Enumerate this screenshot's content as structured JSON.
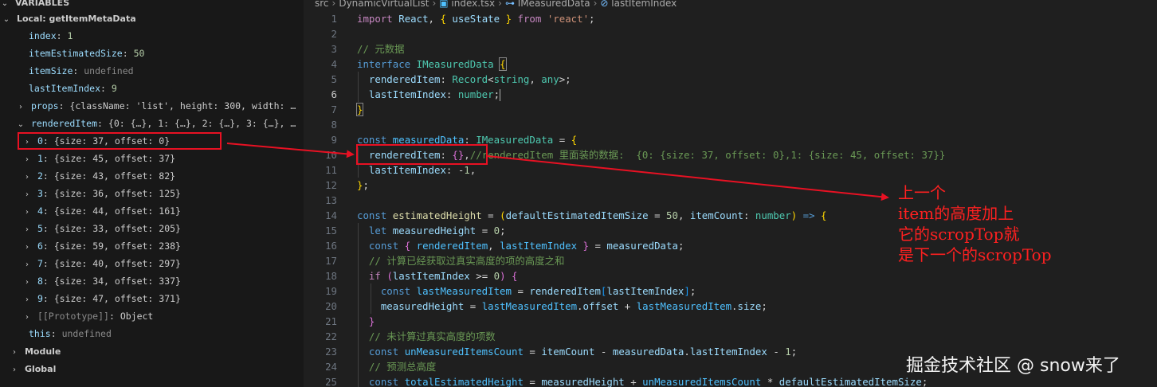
{
  "variables": {
    "header": "VARIABLES",
    "local_scope": "Local: getItemMetaData",
    "locals": [
      {
        "name": "index",
        "value": "1"
      },
      {
        "name": "itemEstimatedSize",
        "value": "50"
      },
      {
        "name": "itemSize",
        "value": "undefined"
      },
      {
        "name": "lastItemIndex",
        "value": "9"
      }
    ],
    "props": {
      "name": "props",
      "value": "{className: 'list', height: 300, width: …"
    },
    "rendered_item": {
      "name": "renderedItem",
      "value": "{0: {…}, 1: {…}, 2: {…}, 3: {…}, …"
    },
    "entries": [
      {
        "key": "0",
        "value": "{size: 37, offset: 0}"
      },
      {
        "key": "1",
        "value": "{size: 45, offset: 37}"
      },
      {
        "key": "2",
        "value": "{size: 43, offset: 82}"
      },
      {
        "key": "3",
        "value": "{size: 36, offset: 125}"
      },
      {
        "key": "4",
        "value": "{size: 44, offset: 161}"
      },
      {
        "key": "5",
        "value": "{size: 33, offset: 205}"
      },
      {
        "key": "6",
        "value": "{size: 59, offset: 238}"
      },
      {
        "key": "7",
        "value": "{size: 40, offset: 297}"
      },
      {
        "key": "8",
        "value": "{size: 34, offset: 337}"
      },
      {
        "key": "9",
        "value": "{size: 47, offset: 371}"
      }
    ],
    "prototype": {
      "name": "[[Prototype]]",
      "value": "Object"
    },
    "this": {
      "name": "this",
      "value": "undefined"
    },
    "scopes": [
      "Module",
      "Global"
    ]
  },
  "breadcrumbs": [
    "src",
    "DynamicVirtualList",
    "index.tsx",
    "IMeasuredData",
    "lastItemIndex"
  ],
  "code": {
    "line_numbers": [
      "1",
      "2",
      "3",
      "4",
      "5",
      "6",
      "7",
      "8",
      "9",
      "10",
      "11",
      "12",
      "13",
      "14",
      "15",
      "16",
      "17",
      "18",
      "19",
      "20",
      "21",
      "22",
      "23",
      "24",
      "25"
    ],
    "comment_metadata": "// 元数据",
    "comment_rendered": "//renderedItem 里面装的数据:  {0: {size: 37, offset: 0},1: {size: 45, offset: 37}}",
    "comment_sum": "// 计算已经获取过真实高度的项的高度之和",
    "comment_unmeasured": "// 未计算过真实高度的项数",
    "comment_total": "// 预测总高度",
    "module_react": "'react'"
  },
  "annotation": {
    "lines": [
      "上一个",
      "item的高度加上",
      "它的scropTop就",
      "是下一个的scropTop"
    ]
  },
  "watermark": "掘金技术社区 @ snow来了",
  "colors": {
    "annotation": "#e81123",
    "selection": "#04395e"
  }
}
